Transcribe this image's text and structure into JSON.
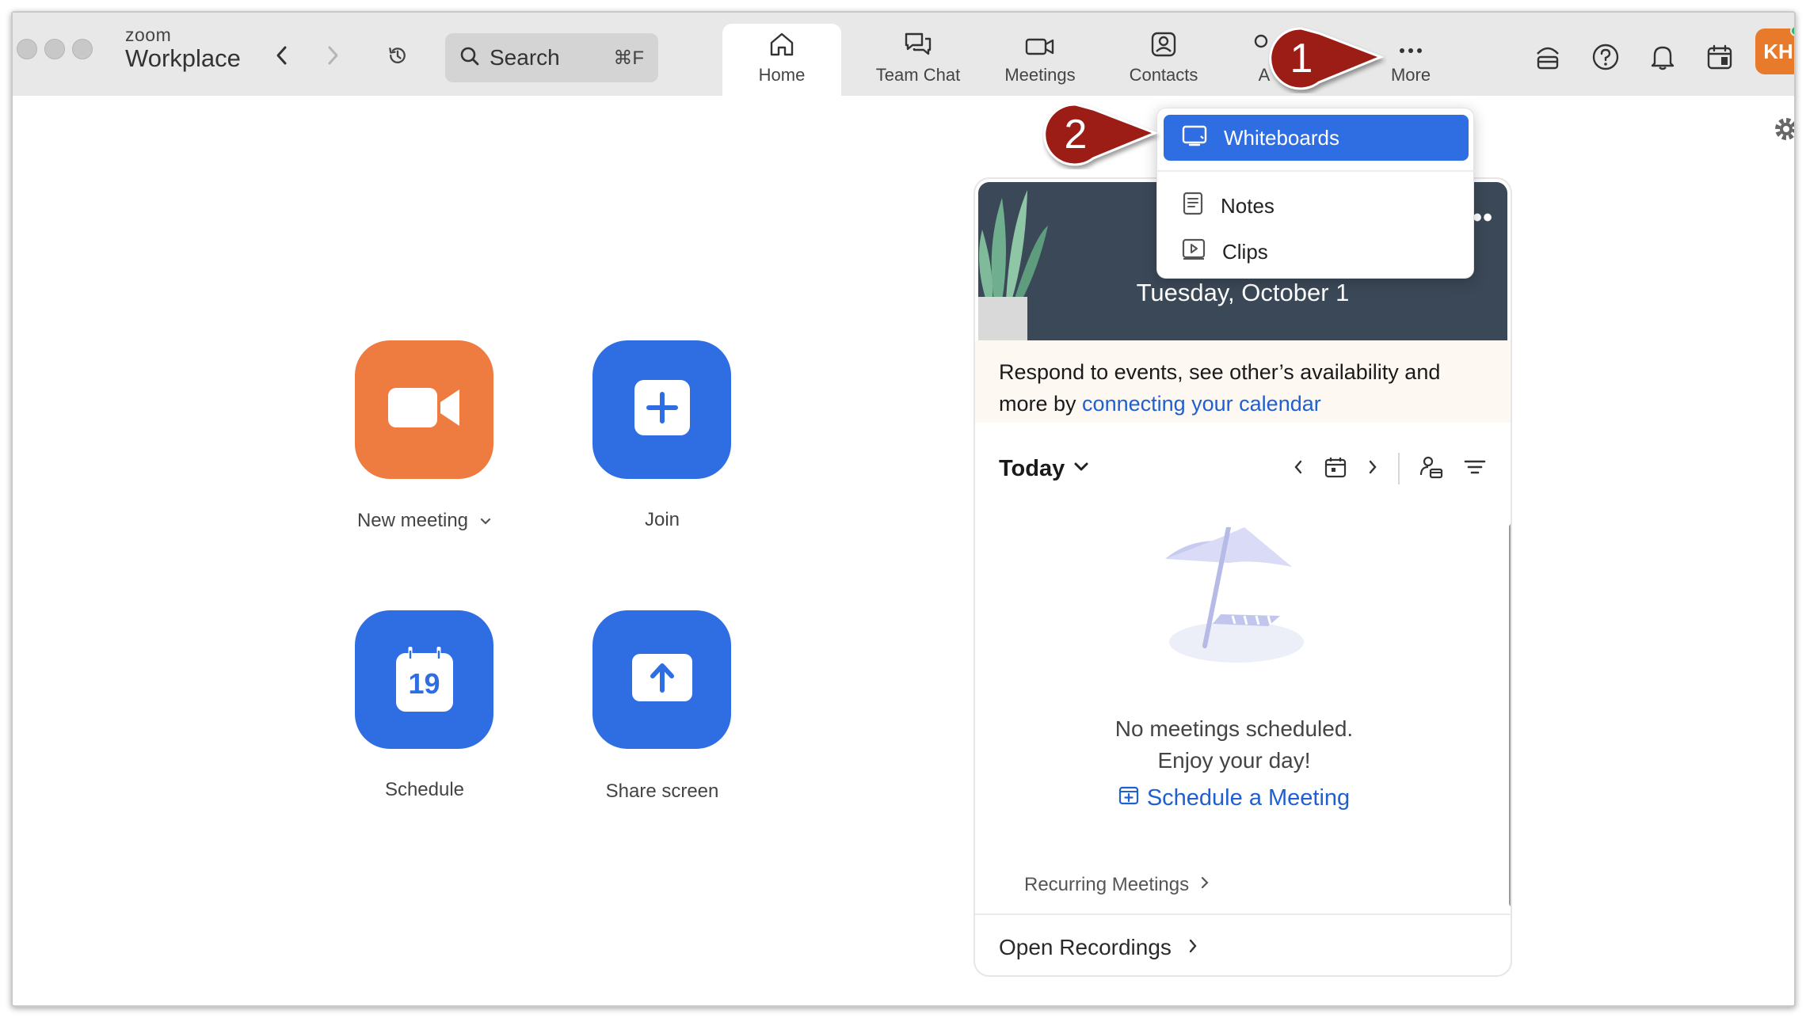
{
  "titlebar": {
    "brand_top": "zoom",
    "brand_bottom": "Workplace",
    "search_label": "Search",
    "search_shortcut": "⌘F"
  },
  "tabs": [
    {
      "label": "Home",
      "icon": "home-icon",
      "active": true
    },
    {
      "label": "Team Chat",
      "icon": "chat-icon"
    },
    {
      "label": "Meetings",
      "icon": "video-icon"
    },
    {
      "label": "Contacts",
      "icon": "contacts-icon"
    },
    {
      "label": "A",
      "icon": "apps-icon"
    },
    {
      "label": "More",
      "icon": "more-icon"
    }
  ],
  "avatar": {
    "initials": "KH",
    "color": "#e87a2b",
    "status_color": "#2fb56a"
  },
  "actions": {
    "new_meeting": "New meeting",
    "join": "Join",
    "schedule": "Schedule",
    "schedule_day": "19",
    "share_screen": "Share screen"
  },
  "colors": {
    "orange": "#ee7c41",
    "blue": "#2f6ee2",
    "link": "#1f5fd1",
    "banner": "#3b4857",
    "callout": "#9c1c17"
  },
  "calendar": {
    "time_partial": "1",
    "date": "Tuesday, October 1",
    "more_dots": "•••",
    "connect_text": "Respond to events, see other’s availability and more by ",
    "connect_link": "connecting your calendar",
    "today_label": "Today",
    "empty_line1": "No meetings scheduled.",
    "empty_line2": "Enjoy your day!",
    "schedule_link": "Schedule a Meeting",
    "recurring": "Recurring Meetings",
    "open_recordings": "Open Recordings"
  },
  "more_menu": {
    "items": [
      {
        "label": "Whiteboards",
        "icon": "whiteboard-icon",
        "selected": true
      },
      {
        "label": "Notes",
        "icon": "notes-icon"
      },
      {
        "label": "Clips",
        "icon": "clips-icon"
      }
    ]
  },
  "callouts": [
    {
      "number": "1",
      "target": "More"
    },
    {
      "number": "2",
      "target": "Whiteboards"
    }
  ]
}
